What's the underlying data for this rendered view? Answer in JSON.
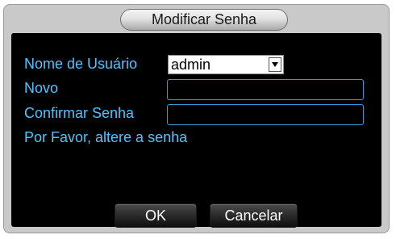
{
  "dialog": {
    "title": "Modificar Senha"
  },
  "form": {
    "username_label": "Nome de Usuário",
    "username_value": "admin",
    "new_label": "Novo",
    "new_value": "",
    "confirm_label": "Confirmar Senha",
    "confirm_value": "",
    "message": "Por Favor, altere a senha"
  },
  "buttons": {
    "ok": "OK",
    "cancel": "Cancelar"
  },
  "colors": {
    "label_text": "#4fc3ff",
    "field_border": "#3a9ad9",
    "panel_bg": "#000000",
    "frame_bg": "#c9c9c9"
  },
  "icons": {
    "dropdown": "triangle-down-icon"
  }
}
